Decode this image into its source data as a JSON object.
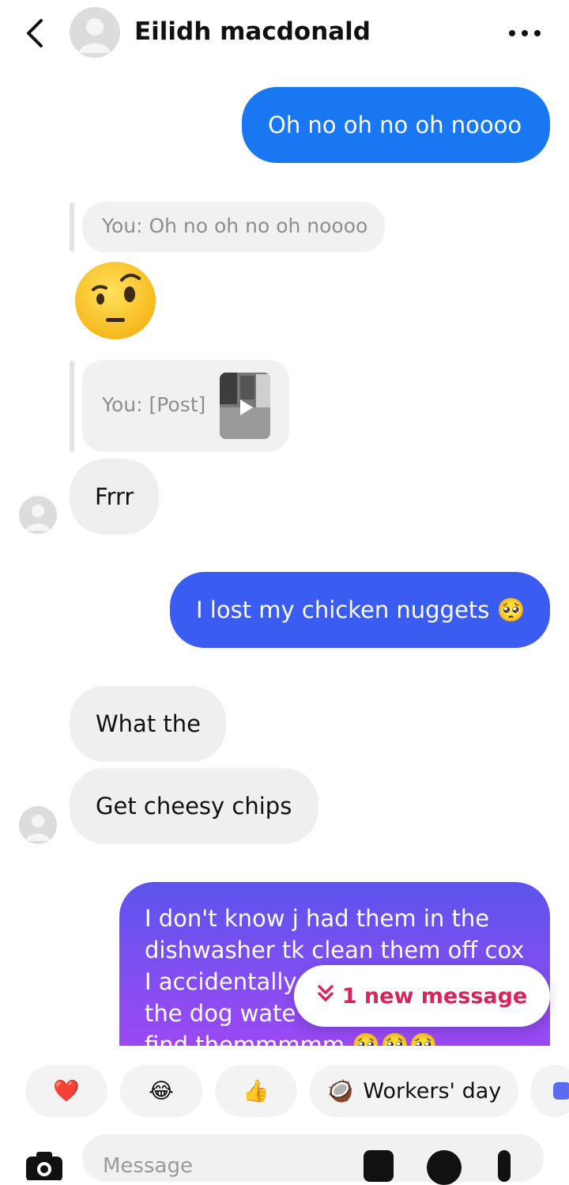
{
  "header": {
    "contact_name": "Eilidh macdonald"
  },
  "messages": {
    "m1": "Oh no oh no oh noooo",
    "reply1": "You: Oh no oh no oh noooo",
    "reaction_emoji": "🤨",
    "reply2": "You: [Post]",
    "m2": "Frrr",
    "m3": "I lost my chicken nuggets 🥺",
    "m4": "What the",
    "m5": "Get cheesy chips",
    "m6_l1": "I don't know j had them in the",
    "m6_l2": "dishwasher tk clean them off cox",
    "m6_l3": "I accidentally",
    "m6_l4": "the dog wate",
    "m6_l5": "find themmmmm 🥺🥺🥺"
  },
  "new_message_pill": "1 new message",
  "quick_replies": {
    "heart": "❤️",
    "laugh": "😂",
    "thumbs": "👍",
    "workers_emoji": "🥥",
    "workers_label": "Workers' day"
  },
  "composer": {
    "placeholder": "Message"
  },
  "colors": {
    "bubble_blue": "#1a77f2",
    "bubble_indigo": "#3b5cf0",
    "bubble_purple_start": "#5b54ee",
    "bubble_purple_end": "#9a48f2",
    "incoming_bubble": "#efefef",
    "new_message_text": "#d6245c"
  }
}
